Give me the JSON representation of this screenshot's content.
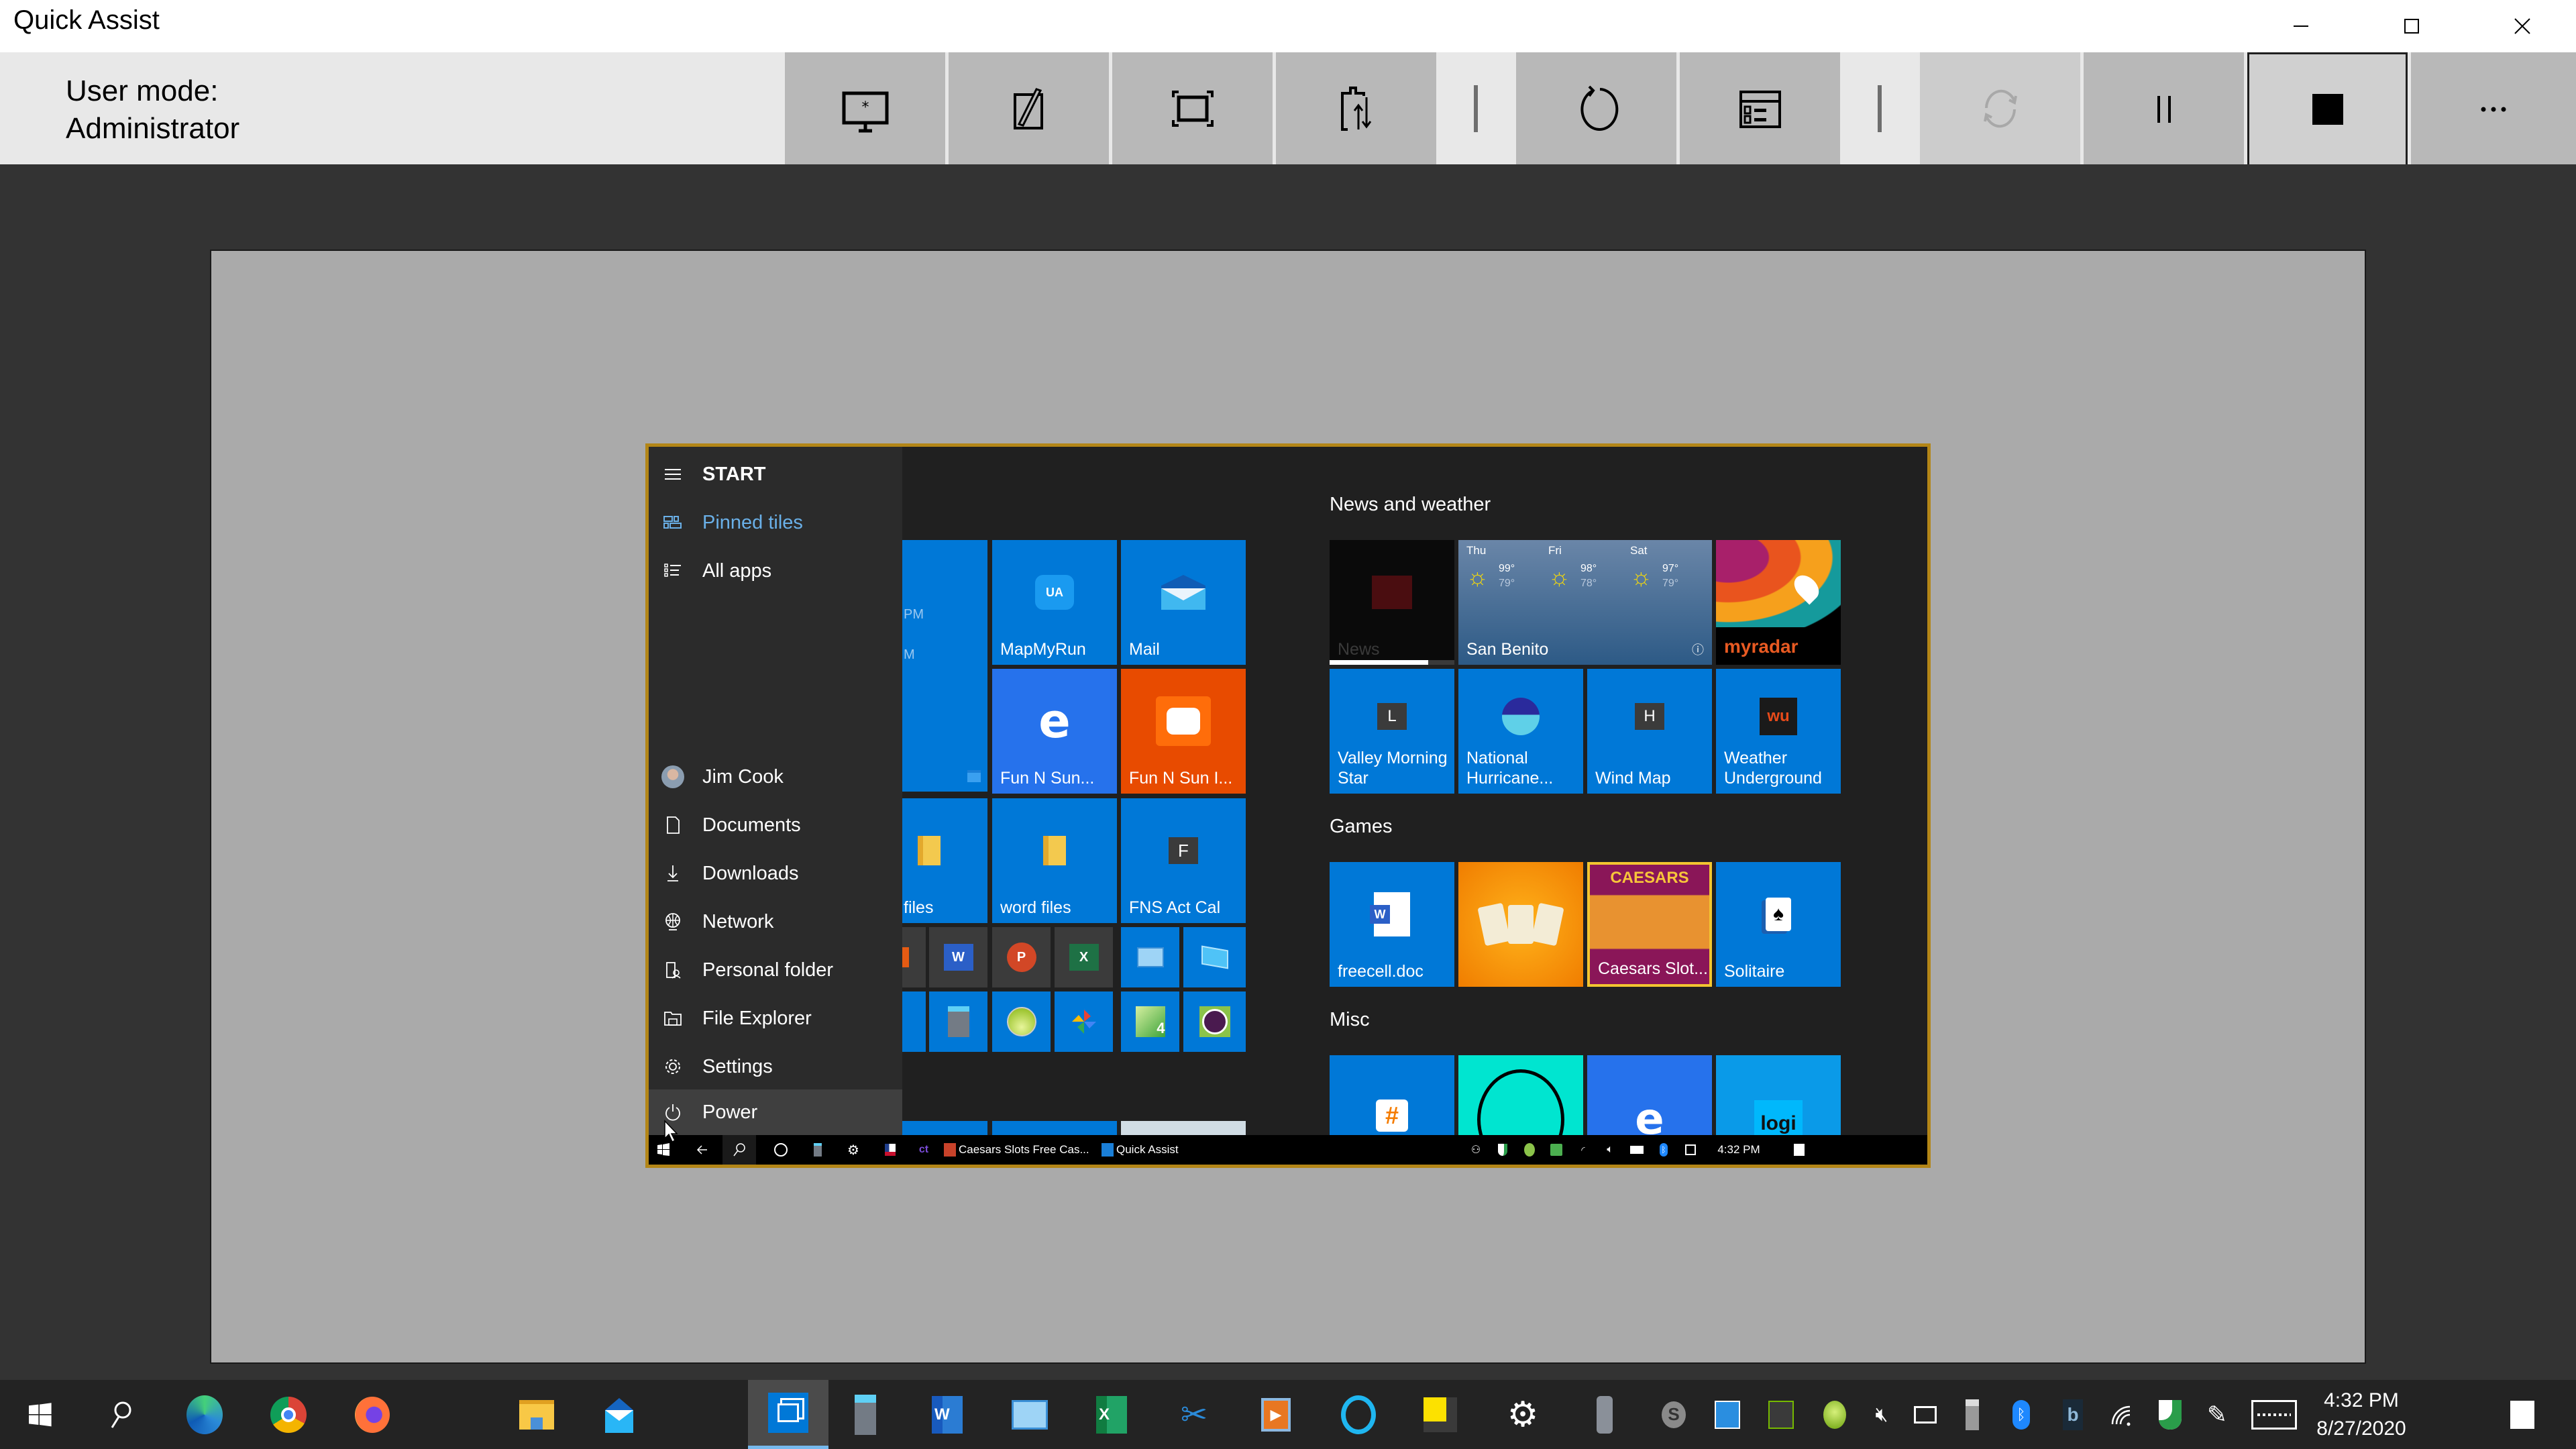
{
  "window": {
    "title": "Quick Assist",
    "controls": [
      "minimize",
      "maximize",
      "close"
    ]
  },
  "toolbar": {
    "user_mode_label": "User mode:",
    "user_mode_value": "Administrator",
    "buttons": [
      {
        "name": "select-monitor",
        "icon": "monitor-asterisk-icon",
        "state": "enabled"
      },
      {
        "name": "annotate",
        "icon": "pen-icon",
        "state": "enabled"
      },
      {
        "name": "actual-size",
        "icon": "fit-screen-icon",
        "state": "enabled"
      },
      {
        "name": "toggle-instruction-channel",
        "icon": "clipboard-transfer-icon",
        "state": "enabled"
      },
      {
        "name": "restart",
        "icon": "restart-icon",
        "state": "enabled"
      },
      {
        "name": "task-manager",
        "icon": "task-manager-icon",
        "state": "enabled"
      },
      {
        "name": "reconnect",
        "icon": "reconnect-icon",
        "state": "disabled"
      },
      {
        "name": "pause",
        "icon": "pause-icon",
        "state": "enabled"
      },
      {
        "name": "end",
        "icon": "stop-icon",
        "state": "active"
      },
      {
        "name": "more",
        "icon": "more-icon",
        "state": "enabled"
      }
    ]
  },
  "remote": {
    "start_menu": {
      "title": "START",
      "nav": [
        {
          "label": "Pinned tiles",
          "icon": "tiles-icon",
          "selected": true
        },
        {
          "label": "All apps",
          "icon": "list-icon",
          "selected": false
        }
      ],
      "places": [
        {
          "label": "Jim Cook",
          "icon": "avatar"
        },
        {
          "label": "Documents",
          "icon": "document-icon"
        },
        {
          "label": "Downloads",
          "icon": "download-icon"
        },
        {
          "label": "Network",
          "icon": "network-icon"
        },
        {
          "label": "Personal folder",
          "icon": "personal-folder-icon"
        },
        {
          "label": "File Explorer",
          "icon": "file-explorer-icon"
        },
        {
          "label": "Settings",
          "icon": "settings-icon"
        },
        {
          "label": "Power",
          "icon": "power-icon"
        }
      ]
    },
    "tiles_left": {
      "calendar_partial": [
        "PM",
        "M"
      ],
      "items": [
        {
          "label": "MapMyRun",
          "color": "#0078d7"
        },
        {
          "label": "Mail",
          "color": "#0078d7"
        },
        {
          "label": "Fun N Sun...",
          "color": "#2672ec"
        },
        {
          "label": "Fun N Sun I...",
          "color": "#e84b00"
        },
        {
          "label": "files",
          "color": "#0078d7"
        },
        {
          "label": "word files",
          "color": "#0078d7"
        },
        {
          "label": "FNS Act Cal",
          "color": "#0078d7",
          "badge": "F"
        }
      ],
      "small_tiles": [
        "Word",
        "PowerPoint",
        "Excel",
        "Control Panel",
        "This PC",
        "Calculator",
        "Green Orb",
        "Google Photos",
        "Green 4",
        "Lock App"
      ]
    },
    "groups": [
      {
        "title": "News and weather",
        "tiles": [
          {
            "label": "News"
          },
          {
            "label": "San Benito",
            "forecast": [
              {
                "day": "Thu",
                "high": "99°",
                "low": "79°"
              },
              {
                "day": "Fri",
                "high": "98°",
                "low": "78°"
              },
              {
                "day": "Sat",
                "high": "97°",
                "low": "79°"
              }
            ]
          },
          {
            "label": "myradar"
          },
          {
            "label": "Valley Morning Star",
            "badge": "L"
          },
          {
            "label": "National Hurricane..."
          },
          {
            "label": "Wind Map",
            "badge": "H"
          },
          {
            "label": "Weather Underground"
          }
        ]
      },
      {
        "title": "Games",
        "tiles": [
          {
            "label": "freecell.doc"
          },
          {
            "label": ""
          },
          {
            "label": "Caesars Slot..."
          },
          {
            "label": "Solitaire"
          }
        ]
      },
      {
        "title": "Misc",
        "tiles": [
          {
            "label": ""
          },
          {
            "label": ""
          },
          {
            "label": ""
          },
          {
            "label": "logi"
          }
        ]
      }
    ],
    "taskbar": {
      "apps": [
        {
          "label": "Caesars Slots Free Cas..."
        },
        {
          "label": "Quick Assist"
        }
      ],
      "time": "4:32 PM"
    }
  },
  "taskbar": {
    "time": "4:32 PM",
    "date": "8/27/2020",
    "pinned": [
      "Start",
      "Search",
      "Edge",
      "Chrome",
      "Firefox",
      "File Explorer",
      "Mail",
      "Quick Assist",
      "Calculator",
      "Word",
      "Control Panel",
      "Excel",
      "Snipping Tool",
      "Media Player",
      "Cortana",
      "Sticky Notes",
      "Settings",
      "Voice Recorder"
    ],
    "active": "Quick Assist"
  }
}
